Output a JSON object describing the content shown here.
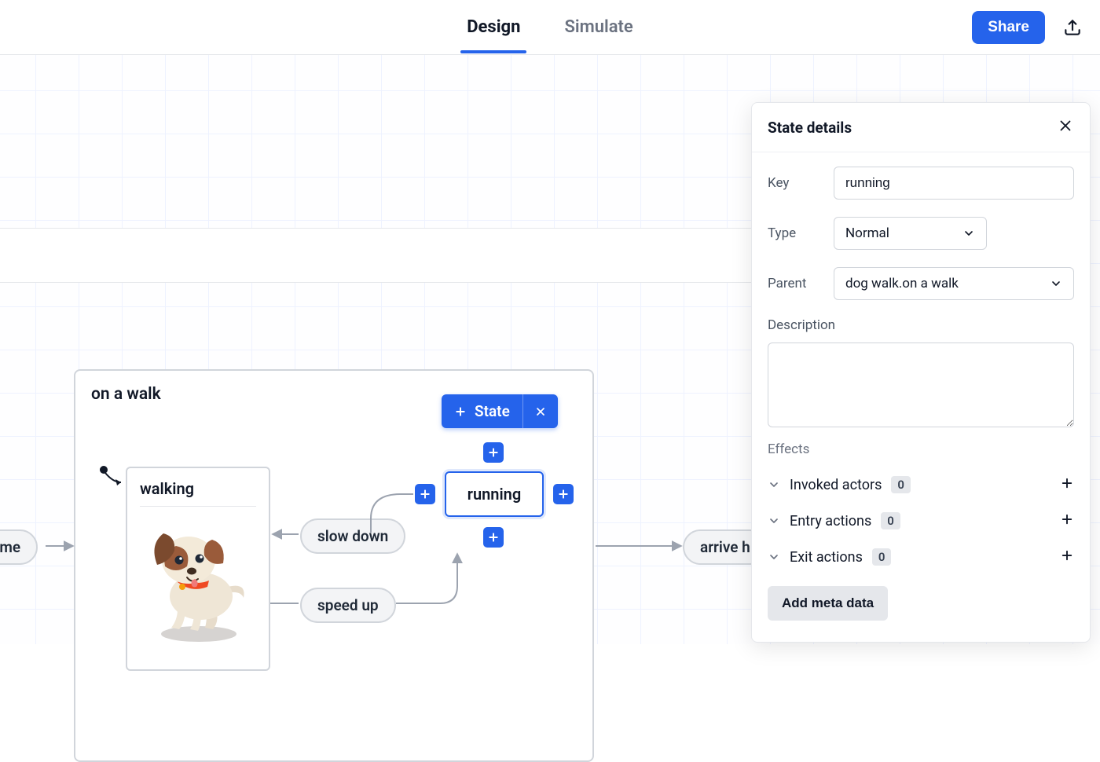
{
  "topbar": {
    "tabs": {
      "design": "Design",
      "simulate": "Simulate",
      "active": "design"
    },
    "share_label": "Share"
  },
  "canvas": {
    "parent_state_title": "on a walk",
    "add_state_label": "State",
    "states": {
      "walking_label": "walking",
      "running_label": "running"
    },
    "transitions": {
      "leave_home": "home",
      "slow_down": "slow down",
      "speed_up": "speed up",
      "arrive_home": "arrive h"
    }
  },
  "inspector": {
    "title": "State details",
    "key_label": "Key",
    "key_value": "running",
    "type_label": "Type",
    "type_value": "Normal",
    "parent_label": "Parent",
    "parent_value": "dog walk.on a walk",
    "description_label": "Description",
    "description_value": "",
    "effects_label": "Effects",
    "effects": {
      "invoked_actors": {
        "label": "Invoked actors",
        "count": "0"
      },
      "entry_actions": {
        "label": "Entry actions",
        "count": "0"
      },
      "exit_actions": {
        "label": "Exit actions",
        "count": "0"
      }
    },
    "add_meta_label": "Add meta data"
  }
}
